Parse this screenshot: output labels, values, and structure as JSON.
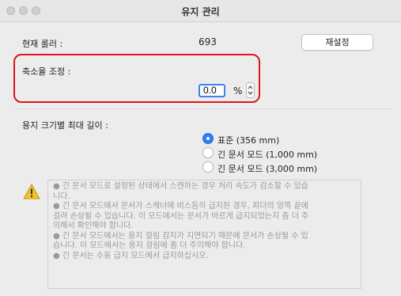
{
  "window": {
    "title": "유지 관리"
  },
  "roller": {
    "label": "현재 롤러 :",
    "value": "693",
    "reset_button": "재설정"
  },
  "scale": {
    "label": "축소율 조정 :",
    "value": "0.0",
    "unit": "%"
  },
  "paper": {
    "label": "용지 크기별 최대 길이 :",
    "options": [
      {
        "label": "표준 (356 mm)",
        "selected": true
      },
      {
        "label": "긴 문서 모드 (1,000 mm)",
        "selected": false
      },
      {
        "label": "긴 문서 모드 (3,000 mm)",
        "selected": false
      }
    ]
  },
  "warning": {
    "icon": "warning-triangle-icon",
    "lines": [
      "● 긴 문서 모드로 설정된 상태에서 스캔하는 경우 처리 속도가 감소할 수 있습",
      "니다.",
      "● 긴 문서 모드에서 문서가 스캐너에 비스듬히 급지된 경우, 피더의 양쪽 끝에",
      "걸려 손상될 수 있습니다. 이 모드에서는 문서가 바르게 급지되었는지 좀 더 주",
      "의해서 확인해야 합니다.",
      "● 긴 문서 모드에서는 용지 걸림 감지가 지연되기 때문에 문서가 손상될 수 있",
      "습니다. 이 모드에서는 용지 걸림에 좀 더 주의해야 합니다.",
      "● 긴 문서는 수동 급지 모드에서 급지하십시오."
    ]
  },
  "colors": {
    "highlight": "#e0141e",
    "accent": "#2f7ff3"
  }
}
